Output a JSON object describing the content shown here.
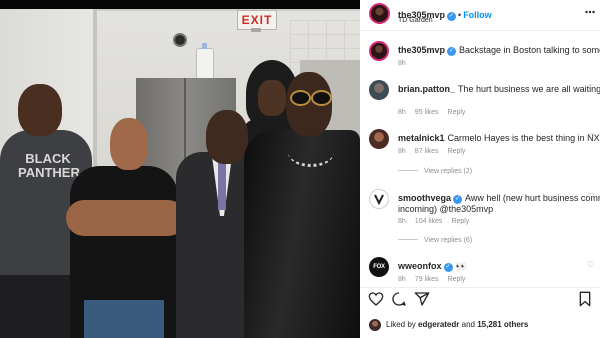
{
  "post": {
    "username": "the305mvp",
    "follow_label": "Follow",
    "location": "TD Garden",
    "caption": {
      "username": "the305mvp",
      "text": "Backstage in Boston talking to some peo",
      "time": "8h"
    }
  },
  "photo": {
    "exit_sign": "EXIT",
    "shirt_text": "BLACK PANTHER"
  },
  "comments": [
    {
      "username": "brian.patton_",
      "text": "The hurt business we are all waiting for",
      "emoji": "🙏🙏",
      "time": "8h",
      "likes": "95 likes",
      "reply": "Reply"
    },
    {
      "username": "metalnick1",
      "text": "Carmelo Hayes is the best thing in NXT right",
      "time": "8h",
      "likes": "87 likes",
      "reply": "Reply",
      "view_replies": "View replies (2)"
    },
    {
      "username": "smoothvega",
      "text": "Aww hell (new hurt business comments",
      "text2": "incoming) @the305mvp",
      "time": "8h",
      "likes": "104 likes",
      "reply": "Reply",
      "view_replies": "View replies (6)"
    },
    {
      "username": "wweonfox",
      "avatar_text": "FOX WWE",
      "text": "👀",
      "time": "8h",
      "likes": "79 likes",
      "reply": "Reply"
    }
  ],
  "actions": {
    "like_icon": "heart-icon",
    "comment_icon": "comment-icon",
    "share_icon": "share-icon"
  },
  "liked_by": {
    "prefix": "Liked by",
    "user": "edgeratedr",
    "conj": "and",
    "count": "15,281 others"
  },
  "colors": {
    "accent_blue": "#0095f6",
    "verified_blue": "#3897f0",
    "text": "#262626",
    "muted": "#8e8e8e"
  }
}
